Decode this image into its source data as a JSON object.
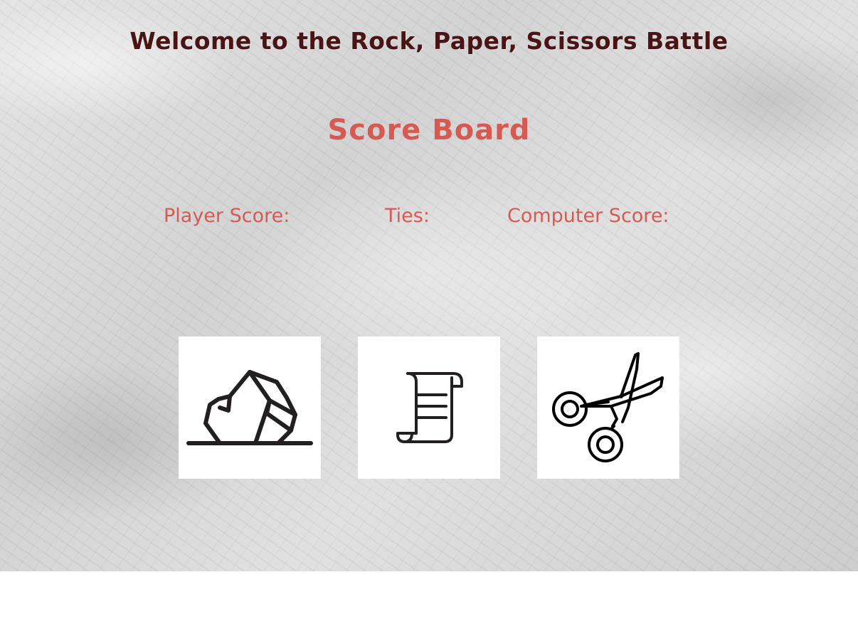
{
  "header": {
    "title": "Welcome to the Rock, Paper, Scissors Battle"
  },
  "scoreboard": {
    "title": "Score Board",
    "player_label": "Player Score:",
    "ties_label": "Ties:",
    "computer_label": "Computer Score:"
  },
  "choices": [
    {
      "name": "rock",
      "icon": "rock-icon"
    },
    {
      "name": "paper",
      "icon": "paper-scroll-icon"
    },
    {
      "name": "scissors",
      "icon": "scissors-icon"
    }
  ],
  "colors": {
    "title": "#4a1416",
    "scoreboard": "#d65a52",
    "icon_stroke": "#231f20",
    "card_background": "#ffffff"
  }
}
